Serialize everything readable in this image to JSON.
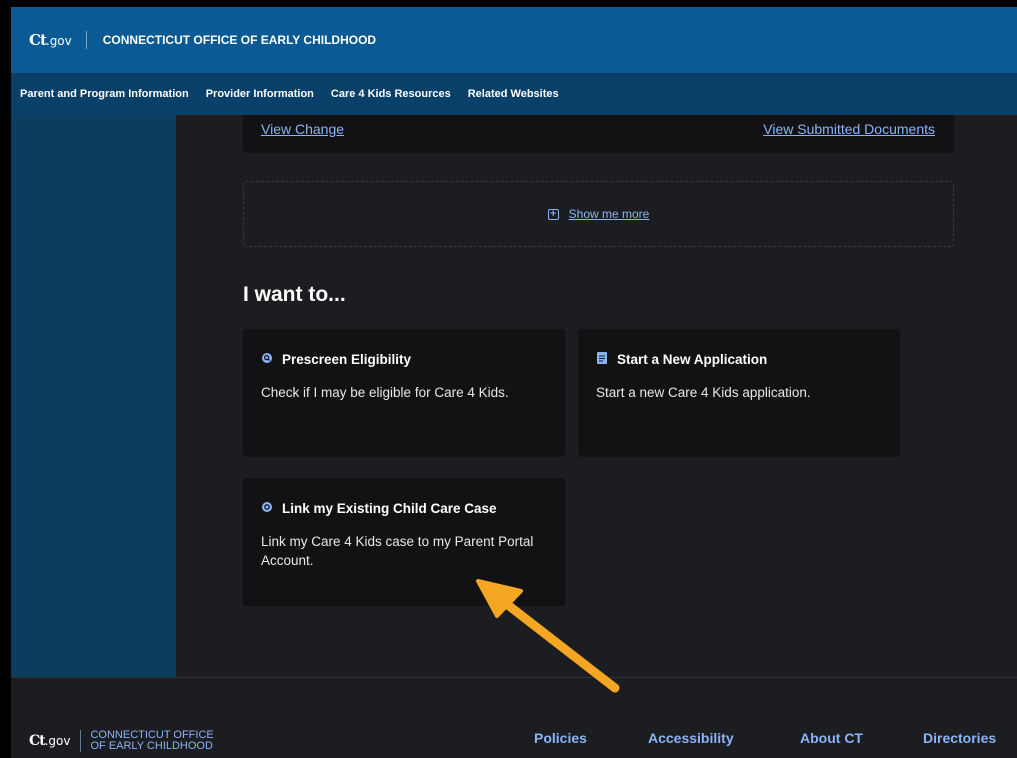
{
  "header": {
    "logo": "Ct.gov",
    "logo_main": "Ct",
    "logo_sub": ".gov",
    "agency": "CONNECTICUT OFFICE OF EARLY CHILDHOOD"
  },
  "nav": {
    "items": [
      {
        "label": "Parent and Program Information"
      },
      {
        "label": "Provider Information"
      },
      {
        "label": "Care 4 Kids Resources"
      },
      {
        "label": "Related Websites"
      }
    ]
  },
  "case_card": {
    "view_change": "View Change",
    "view_submitted": "View Submitted Documents"
  },
  "show_more": {
    "label": "Show me more",
    "icon": "expand-plus-icon"
  },
  "main": {
    "heading": "I want to...",
    "tiles": [
      {
        "title": "Prescreen Eligibility",
        "description": "Check if I may be eligible for Care 4 Kids.",
        "icon": "search-circle-icon"
      },
      {
        "title": "Start a New Application",
        "description": "Start a new Care 4 Kids application.",
        "icon": "document-icon"
      },
      {
        "title": "Link my Existing Child Care Case",
        "description": "Link my Care 4 Kids case to my Parent Portal Account.",
        "icon": "link-circle-icon"
      }
    ]
  },
  "footer": {
    "logo_main": "Ct",
    "logo_sub": ".gov",
    "agency_line1": "CONNECTICUT OFFICE",
    "agency_line2": "OF EARLY CHILDHOOD",
    "links": [
      {
        "label": "Policies"
      },
      {
        "label": "Accessibility"
      },
      {
        "label": "About CT"
      },
      {
        "label": "Directories"
      }
    ]
  },
  "colors": {
    "header_bg": "#0b5a94",
    "nav_bg": "#08406a",
    "sidebar_bg": "#0a3d5e",
    "page_bg": "#1c1d20",
    "card_bg": "#121214",
    "link": "#8ab4f8",
    "annotation_arrow": "#f5a623"
  }
}
